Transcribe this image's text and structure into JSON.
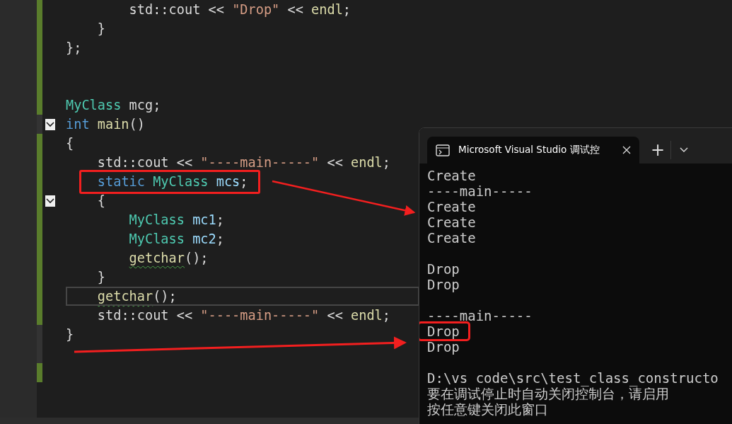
{
  "editor": {
    "lines": [
      {
        "children": [
          {
            "children": [
              {
                "modified": true,
                "tokens": [
                  {
                    "kind": "plain",
                    "text": "std::cout << "
                  },
                  {
                    "kind": "string",
                    "text": "\"Drop\""
                  },
                  {
                    "kind": "plain",
                    "text": " << "
                  },
                  {
                    "kind": "func",
                    "text": "endl"
                  },
                  {
                    "kind": "plain",
                    "text": ";"
                  }
                ]
              }
            ]
          },
          {
            "modified": true,
            "tokens": [
              {
                "kind": "plain",
                "text": "}"
              }
            ]
          }
        ]
      },
      {
        "modified": true,
        "tokens": [
          {
            "kind": "plain",
            "text": "};"
          }
        ]
      },
      {
        "modified": true
      },
      {
        "modified": true
      },
      {
        "modified": true,
        "tokens": [
          {
            "kind": "type",
            "text": "MyClass"
          },
          {
            "kind": "plain",
            "text": " mcg;"
          }
        ]
      },
      {
        "modified": false,
        "expanded": true,
        "tokens": [
          {
            "kind": "keyword",
            "text": "int "
          },
          {
            "kind": "func",
            "text": "main"
          },
          {
            "kind": "plain",
            "text": "()"
          }
        ]
      },
      {
        "modified": true,
        "tokens": [
          {
            "kind": "plain",
            "text": "{"
          }
        ],
        "children": [
          {
            "modified": true,
            "tokens": [
              {
                "kind": "plain",
                "text": "std::cout << "
              },
              {
                "kind": "string",
                "text": "\"----main-----\""
              },
              {
                "kind": "plain",
                "text": " << "
              },
              {
                "kind": "func",
                "text": "endl"
              },
              {
                "kind": "plain",
                "text": ";"
              }
            ]
          },
          {
            "modified": true,
            "highlight": true,
            "tokens": [
              {
                "kind": "keyword",
                "text": "static "
              },
              {
                "kind": "type",
                "text": "MyClass "
              },
              {
                "kind": "var",
                "text": "mcs"
              },
              {
                "kind": "plain",
                "text": ";"
              }
            ]
          },
          {
            "modified": true,
            "expanded": true,
            "tokens": [
              {
                "kind": "plain",
                "text": "{"
              }
            ],
            "children": [
              {
                "modified": true,
                "tokens": [
                  {
                    "kind": "type",
                    "text": "MyClass "
                  },
                  {
                    "kind": "var",
                    "text": "mc1"
                  },
                  {
                    "kind": "plain",
                    "text": ";"
                  }
                ]
              },
              {
                "modified": true,
                "tokens": [
                  {
                    "kind": "type",
                    "text": "MyClass "
                  },
                  {
                    "kind": "var",
                    "text": "mc2"
                  },
                  {
                    "kind": "plain",
                    "text": ";"
                  }
                ]
              },
              {
                "modified": true,
                "tokens": [
                  {
                    "kind": "func",
                    "text": "getchar",
                    "squiggle": true
                  },
                  {
                    "kind": "plain",
                    "text": "();"
                  }
                ]
              }
            ]
          },
          {
            "modified": true,
            "tokens": [
              {
                "kind": "plain",
                "text": "}"
              }
            ]
          },
          {
            "modified": true,
            "current": true,
            "tokens": [
              {
                "kind": "func",
                "text": "getchar",
                "squiggle": true
              },
              {
                "kind": "plain",
                "text": "();"
              }
            ]
          },
          {
            "modified": true,
            "tokens": [
              {
                "kind": "plain",
                "text": "std::cout << "
              },
              {
                "kind": "string",
                "text": "\"----main-----\""
              },
              {
                "kind": "plain",
                "text": " << "
              },
              {
                "kind": "func",
                "text": "endl"
              },
              {
                "kind": "plain",
                "text": ";"
              }
            ]
          }
        ]
      },
      {
        "modified": false,
        "tokens": [
          {
            "kind": "plain",
            "text": "}"
          }
        ]
      },
      {
        "modified": false
      },
      {
        "modified": true
      }
    ]
  },
  "console": {
    "tab_title": "Microsoft Visual Studio 调试控",
    "new_tab": "+",
    "blocks": [
      {
        "lines": [
          {
            "text": "Create"
          },
          {
            "text": "----main-----"
          },
          {
            "text": "Create"
          },
          {
            "text": "Create"
          },
          {
            "text": "Create"
          }
        ]
      },
      {
        "lines": [
          {
            "text": "Drop"
          },
          {
            "text": "Drop"
          }
        ]
      },
      {
        "lines": [
          {
            "text": "----main-----"
          },
          {
            "text": "Drop",
            "highlight": true
          },
          {
            "text": "Drop"
          }
        ]
      },
      {
        "lines": [
          {
            "text": "D:\\vs code\\src\\test_class_constructo"
          },
          {
            "text": "要在调试停止时自动关闭控制台，请启用"
          },
          {
            "text": "按任意键关闭此窗口"
          }
        ]
      }
    ]
  }
}
